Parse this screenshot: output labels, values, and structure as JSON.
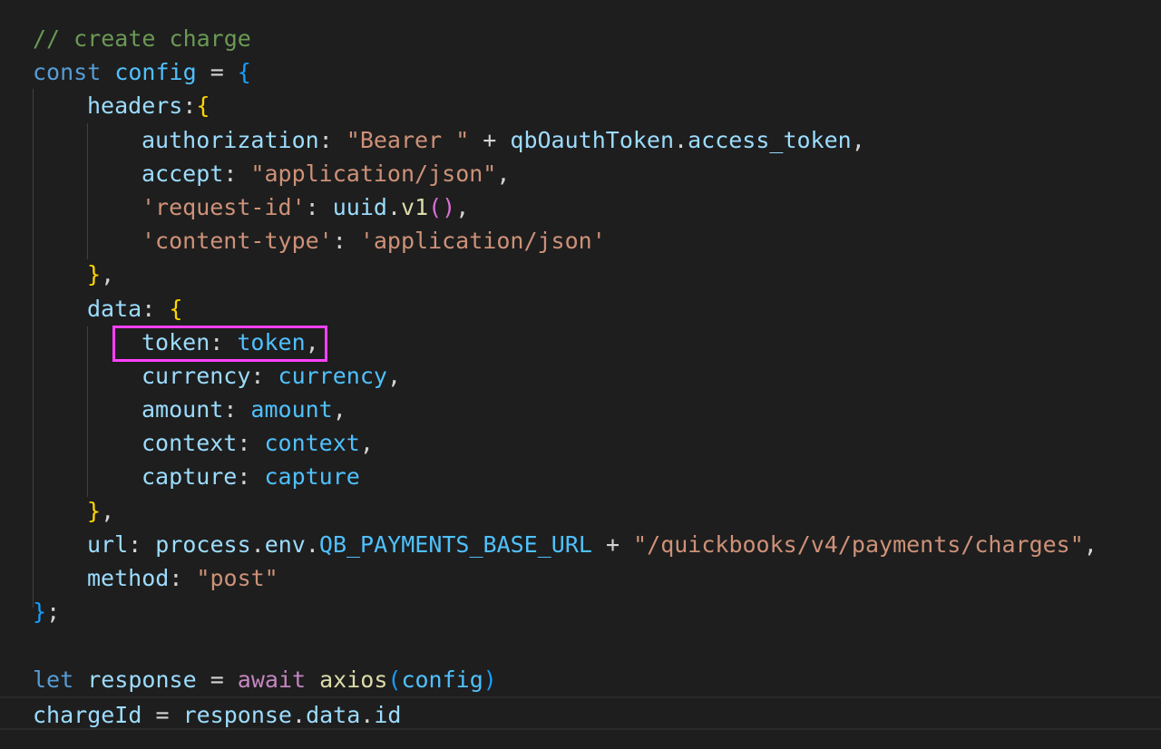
{
  "colors": {
    "background": "#1e1e1e",
    "comment": "#6a9955",
    "keyword": "#569cd6",
    "variable": "#4fc1ff",
    "property": "#9cdcfe",
    "string": "#ce9178",
    "function": "#dcdcaa",
    "control": "#c586c0",
    "highlight": "#ff40ff"
  },
  "code": {
    "l1_comment": "// create charge",
    "l2_const": "const",
    "l2_config": "config",
    "l2_eq": " = ",
    "l2_brace": "{",
    "l3_headers": "headers",
    "l3_colon": ":",
    "l3_brace": "{",
    "l4_key": "authorization",
    "l4_colon": ": ",
    "l4_str": "\"Bearer \"",
    "l4_plus": " + ",
    "l4_obj": "qbOauthToken",
    "l4_dot": ".",
    "l4_prop": "access_token",
    "l4_comma": ",",
    "l5_key": "accept",
    "l5_colon": ": ",
    "l5_str": "\"application/json\"",
    "l5_comma": ",",
    "l6_key": "'request-id'",
    "l6_colon": ": ",
    "l6_obj": "uuid",
    "l6_dot": ".",
    "l6_func": "v1",
    "l6_parens": "()",
    "l6_comma": ",",
    "l7_key": "'content-type'",
    "l7_colon": ": ",
    "l7_str": "'application/json'",
    "l8_brace": "}",
    "l8_comma": ",",
    "l9_data": "data",
    "l9_colon": ": ",
    "l9_brace": "{",
    "l10_key": "token",
    "l10_colon": ": ",
    "l10_val": "token",
    "l10_comma": ",",
    "l11_key": "currency",
    "l11_colon": ": ",
    "l11_val": "currency",
    "l11_comma": ",",
    "l12_key": "amount",
    "l12_colon": ": ",
    "l12_val": "amount",
    "l12_comma": ",",
    "l13_key": "context",
    "l13_colon": ": ",
    "l13_val": "context",
    "l13_comma": ",",
    "l14_key": "capture",
    "l14_colon": ": ",
    "l14_val": "capture",
    "l15_brace": "}",
    "l15_comma": ",",
    "l16_key": "url",
    "l16_colon": ": ",
    "l16_process": "process",
    "l16_dot1": ".",
    "l16_env": "env",
    "l16_dot2": ".",
    "l16_const": "QB_PAYMENTS_BASE_URL",
    "l16_plus": " + ",
    "l16_str": "\"/quickbooks/v4/payments/charges\"",
    "l16_comma": ",",
    "l17_key": "method",
    "l17_colon": ": ",
    "l17_str": "\"post\"",
    "l18_brace": "}",
    "l18_semi": ";",
    "l20_let": "let",
    "l20_var": "response",
    "l20_eq": " = ",
    "l20_await": "await",
    "l20_func": "axios",
    "l20_paren_open": "(",
    "l20_arg": "config",
    "l20_paren_close": ")",
    "l21_var": "chargeId",
    "l21_eq": " = ",
    "l21_obj": "response",
    "l21_dot1": ".",
    "l21_prop1": "data",
    "l21_dot2": ".",
    "l21_prop2": "id"
  }
}
